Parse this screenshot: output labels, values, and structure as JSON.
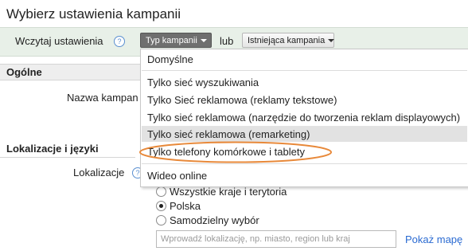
{
  "page": {
    "title": "Wybierz ustawienia kampanii"
  },
  "settings_bar": {
    "load_label": "Wczytaj ustawienia",
    "help_icon": "?",
    "type_button_label": "Typ kampanii",
    "or_label": "lub",
    "existing_button_label": "Istniejąca kampania"
  },
  "dropdown": {
    "items": [
      "Domyślne",
      "Tylko sieć wyszukiwania",
      "Tylko Sieć reklamowa (reklamy tekstowe)",
      "Tylko sieć reklamowa (narzędzie do tworzenia reklam displayowych)",
      "Tylko sieć reklamowa (remarketing)",
      "Tylko telefony komórkowe i tablety",
      "Wideo online"
    ],
    "highlighted_item": "Tylko sieć reklamowa (remarketing)",
    "circled_item": "Tylko telefony komórkowe i tablety",
    "annotation_color": "#e8893a"
  },
  "sections": {
    "general": {
      "heading": "Ogólne",
      "name_label": "Nazwa kampan"
    },
    "locations": {
      "heading": "Lokalizacje i języki",
      "location_label": "Lokalizacje",
      "options": [
        {
          "label": "Wszystkie kraje i terytoria",
          "checked": false
        },
        {
          "label": "Polska",
          "checked": true
        },
        {
          "label": "Samodzielny wybór",
          "checked": false
        }
      ],
      "search_placeholder": "Wprowadź lokalizację, np. miasto, region lub kraj",
      "map_link": "Pokaż mapę"
    }
  }
}
